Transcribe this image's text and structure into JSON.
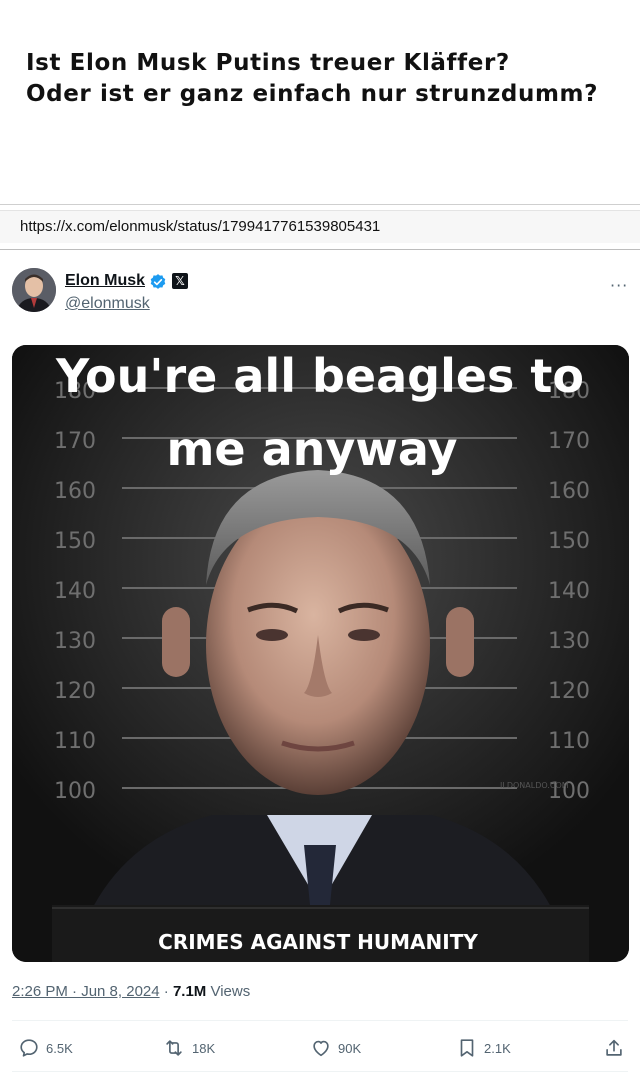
{
  "headline": {
    "line1": "Ist Elon Musk Putins treuer Kläffer?",
    "line2": "Oder ist er ganz einfach nur strunzdumm?"
  },
  "url": "https://x.com/elonmusk/status/1799417761539805431",
  "tweet": {
    "author_name": "Elon Musk",
    "author_handle": "@elonmusk",
    "more_label": "···",
    "x_label": "𝕏",
    "image": {
      "caption_line1": "You're all beagles to",
      "caption_line2": "me anyway",
      "banner": "CRIMES AGAINST HUMANITY",
      "watermark": "ILDONALDO.COM",
      "height_ticks_left": [
        "180",
        "170",
        "160",
        "150",
        "140",
        "130",
        "120",
        "110",
        "100"
      ],
      "height_ticks_right": [
        "180",
        "170",
        "160",
        "150",
        "140",
        "130",
        "120",
        "110",
        "100"
      ]
    },
    "time": "2:26 PM · Jun 8, 2024",
    "separator": " · ",
    "views_count": "7.1M",
    "views_label": " Views",
    "actions": {
      "replies": "6.5K",
      "reposts": "18K",
      "likes": "90K",
      "bookmarks": "2.1K"
    }
  },
  "colors": {
    "accent": "#1d9bf0",
    "muted": "#536471",
    "text": "#0f1419"
  }
}
